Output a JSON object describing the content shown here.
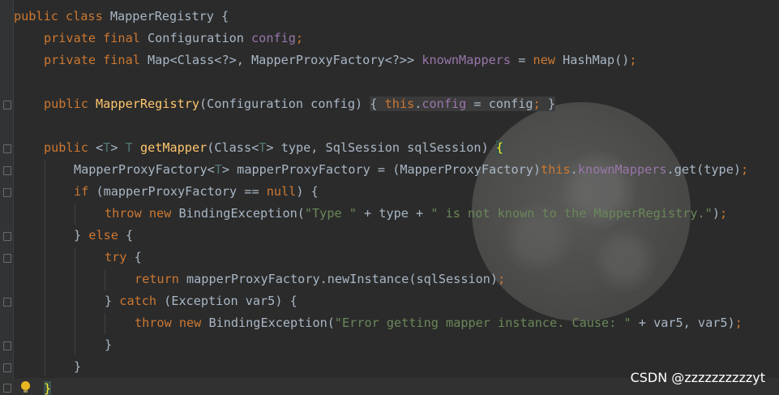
{
  "code": {
    "l1": {
      "a": "public class ",
      "b": "MapperRegistry {"
    },
    "l2": {
      "a": "private final ",
      "b": "Configuration ",
      "c": "config",
      "d": ";"
    },
    "l3": {
      "a": "private final ",
      "b": "Map<Class<?>, MapperProxyFactory<?>> ",
      "c": "knownMappers",
      "d": " = ",
      "e": "new ",
      "f": "HashMap()",
      "g": ";"
    },
    "l5": {
      "a": "public ",
      "b": "MapperRegistry",
      "c": "(Configuration config) ",
      "d": "{",
      "e": " ",
      "f": "this",
      "g": ".",
      "h": "config",
      "i": " = config",
      "j": ";",
      "k": " }"
    },
    "l7": {
      "a": "public ",
      "b": "<",
      "c": "T",
      "d": "> ",
      "e": "T",
      "f": " ",
      "g": "getMapper",
      "h": "(Class<",
      "i": "T",
      "j": "> type, SqlSession sqlSession) ",
      "k": "{"
    },
    "l8": {
      "a": "MapperProxyFactory<",
      "b": "T",
      "c": "> mapperProxyFactory = (MapperProxyFactory)",
      "d": "this",
      "e": ".",
      "f": "knownMappers",
      "g": ".get(type)",
      "h": ";"
    },
    "l9": {
      "a": "if ",
      "b": "(mapperProxyFactory == ",
      "c": "null",
      "d": ") {"
    },
    "l10": {
      "a": "throw new ",
      "b": "BindingException(",
      "c": "\"Type \"",
      "d": " + type + ",
      "e": "\" is not known to the MapperRegistry.\"",
      "f": ")",
      "g": ";"
    },
    "l11": {
      "a": "} ",
      "b": "else ",
      "c": "{"
    },
    "l12": {
      "a": "try ",
      "b": "{"
    },
    "l13": {
      "a": "return ",
      "b": "mapperProxyFactory.newInstance(sqlSession)",
      "c": ";"
    },
    "l14": {
      "a": "} ",
      "b": "catch ",
      "c": "(Exception var5) {"
    },
    "l15": {
      "a": "throw new ",
      "b": "BindingException(",
      "c": "\"Error getting mapper instance. Cause: \"",
      "d": " + var5, var5)",
      "e": ";"
    },
    "l16": {
      "a": "}"
    },
    "l17": {
      "a": "}"
    },
    "l18": {
      "a": "}"
    }
  },
  "watermark": "CSDN @zzzzzzzzzzyt",
  "colors": {
    "background": "#2b2b2b",
    "keyword": "#cc7832",
    "field": "#9876aa",
    "method": "#ffc66d",
    "string": "#6a8759",
    "type_param": "#507874",
    "plain": "#a9b7c6"
  }
}
